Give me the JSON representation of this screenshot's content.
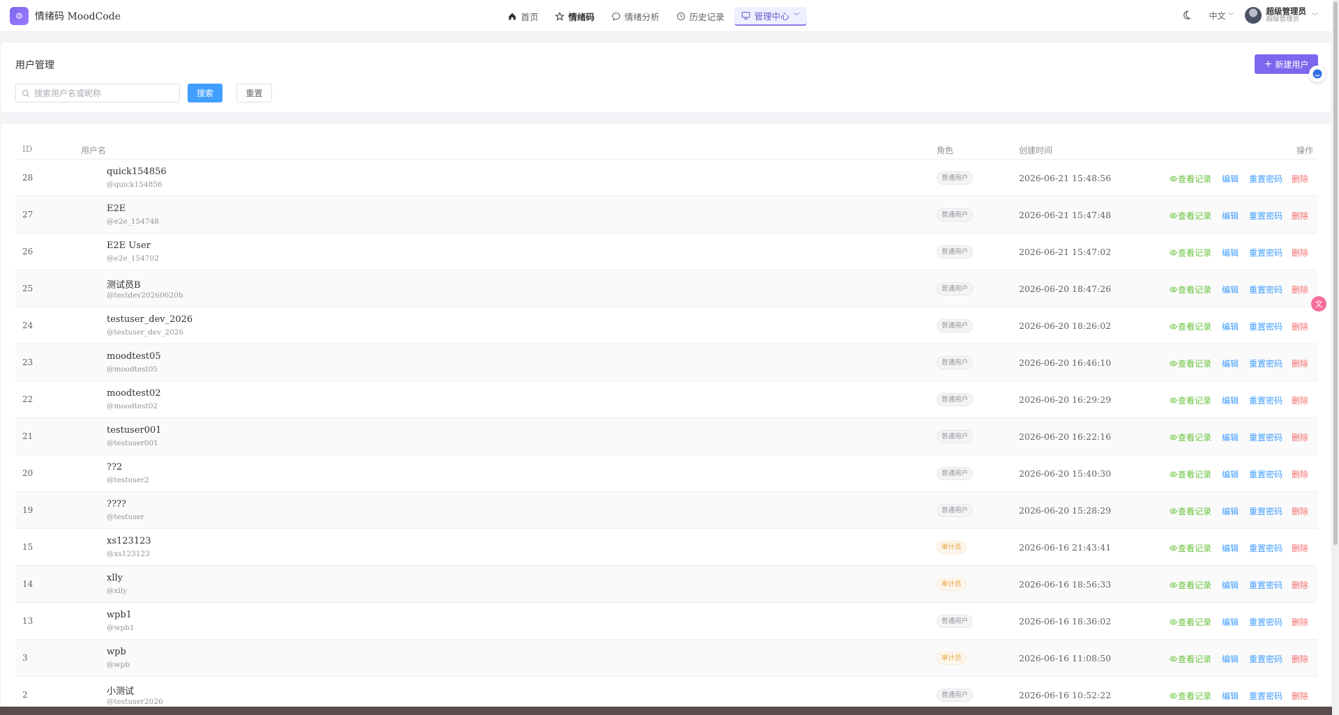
{
  "brand": {
    "title": "情绪码 MoodCode"
  },
  "nav": {
    "home": "首页",
    "moodcode": "情绪码",
    "analysis": "情绪分析",
    "history": "历史记录",
    "admin": "管理中心"
  },
  "header": {
    "lang": "中文",
    "user_name": "超级管理员",
    "user_role": "超级管理员"
  },
  "search": {
    "title": "用户管理",
    "placeholder": "搜索用户名或昵称",
    "search_label": "搜索",
    "reset_label": "重置",
    "create_label": "新建用户"
  },
  "table": {
    "headers": {
      "id": "ID",
      "username": "用户名",
      "role": "角色",
      "created": "创建时间",
      "actions": "操作"
    },
    "action_labels": {
      "view": "查看记录",
      "edit": "编辑",
      "reset": "重置密码",
      "delete": "删除"
    },
    "rows": [
      {
        "id": "28",
        "name": "quick154856",
        "handle": "@quick154856",
        "role": "普通用户",
        "role_type": "normal",
        "created": "2026-06-21 15:48:56"
      },
      {
        "id": "27",
        "name": "E2E",
        "handle": "@e2e_154748",
        "role": "普通用户",
        "role_type": "normal",
        "created": "2026-06-21 15:47:48"
      },
      {
        "id": "26",
        "name": "E2E User",
        "handle": "@e2e_154702",
        "role": "普通用户",
        "role_type": "normal",
        "created": "2026-06-21 15:47:02"
      },
      {
        "id": "25",
        "name": "测试员B",
        "handle": "@testdev20260620b",
        "role": "普通用户",
        "role_type": "normal",
        "created": "2026-06-20 18:47:26"
      },
      {
        "id": "24",
        "name": "testuser_dev_2026",
        "handle": "@testuser_dev_2026",
        "role": "普通用户",
        "role_type": "normal",
        "created": "2026-06-20 18:26:02"
      },
      {
        "id": "23",
        "name": "moodtest05",
        "handle": "@moodtest05",
        "role": "普通用户",
        "role_type": "normal",
        "created": "2026-06-20 16:46:10"
      },
      {
        "id": "22",
        "name": "moodtest02",
        "handle": "@moodtest02",
        "role": "普通用户",
        "role_type": "normal",
        "created": "2026-06-20 16:29:29"
      },
      {
        "id": "21",
        "name": "testuser001",
        "handle": "@testuser001",
        "role": "普通用户",
        "role_type": "normal",
        "created": "2026-06-20 16:22:16"
      },
      {
        "id": "20",
        "name": "??2",
        "handle": "@testuser2",
        "role": "普通用户",
        "role_type": "normal",
        "created": "2026-06-20 15:40:30"
      },
      {
        "id": "19",
        "name": "????",
        "handle": "@testuser",
        "role": "普通用户",
        "role_type": "normal",
        "created": "2026-06-20 15:28:29"
      },
      {
        "id": "15",
        "name": "xs123123",
        "handle": "@xs123123",
        "role": "审计员",
        "role_type": "auditor",
        "created": "2026-06-16 21:43:41"
      },
      {
        "id": "14",
        "name": "xlly",
        "handle": "@xlly",
        "role": "审计员",
        "role_type": "auditor",
        "created": "2026-06-16 18:56:33"
      },
      {
        "id": "13",
        "name": "wpb1",
        "handle": "@wpb1",
        "role": "普通用户",
        "role_type": "normal",
        "created": "2026-06-16 18:36:02"
      },
      {
        "id": "3",
        "name": "wpb",
        "handle": "@wpb",
        "role": "审计员",
        "role_type": "auditor",
        "created": "2026-06-16 11:08:50"
      },
      {
        "id": "2",
        "name": "小测试",
        "handle": "@testuser2026",
        "role": "普通用户",
        "role_type": "normal",
        "created": "2026-06-16 10:52:22"
      }
    ]
  },
  "colors": {
    "brand": "#7b68ee",
    "primary": "#409eff",
    "success": "#67c23a",
    "danger": "#f56c6c",
    "warning": "#e6a23c"
  }
}
